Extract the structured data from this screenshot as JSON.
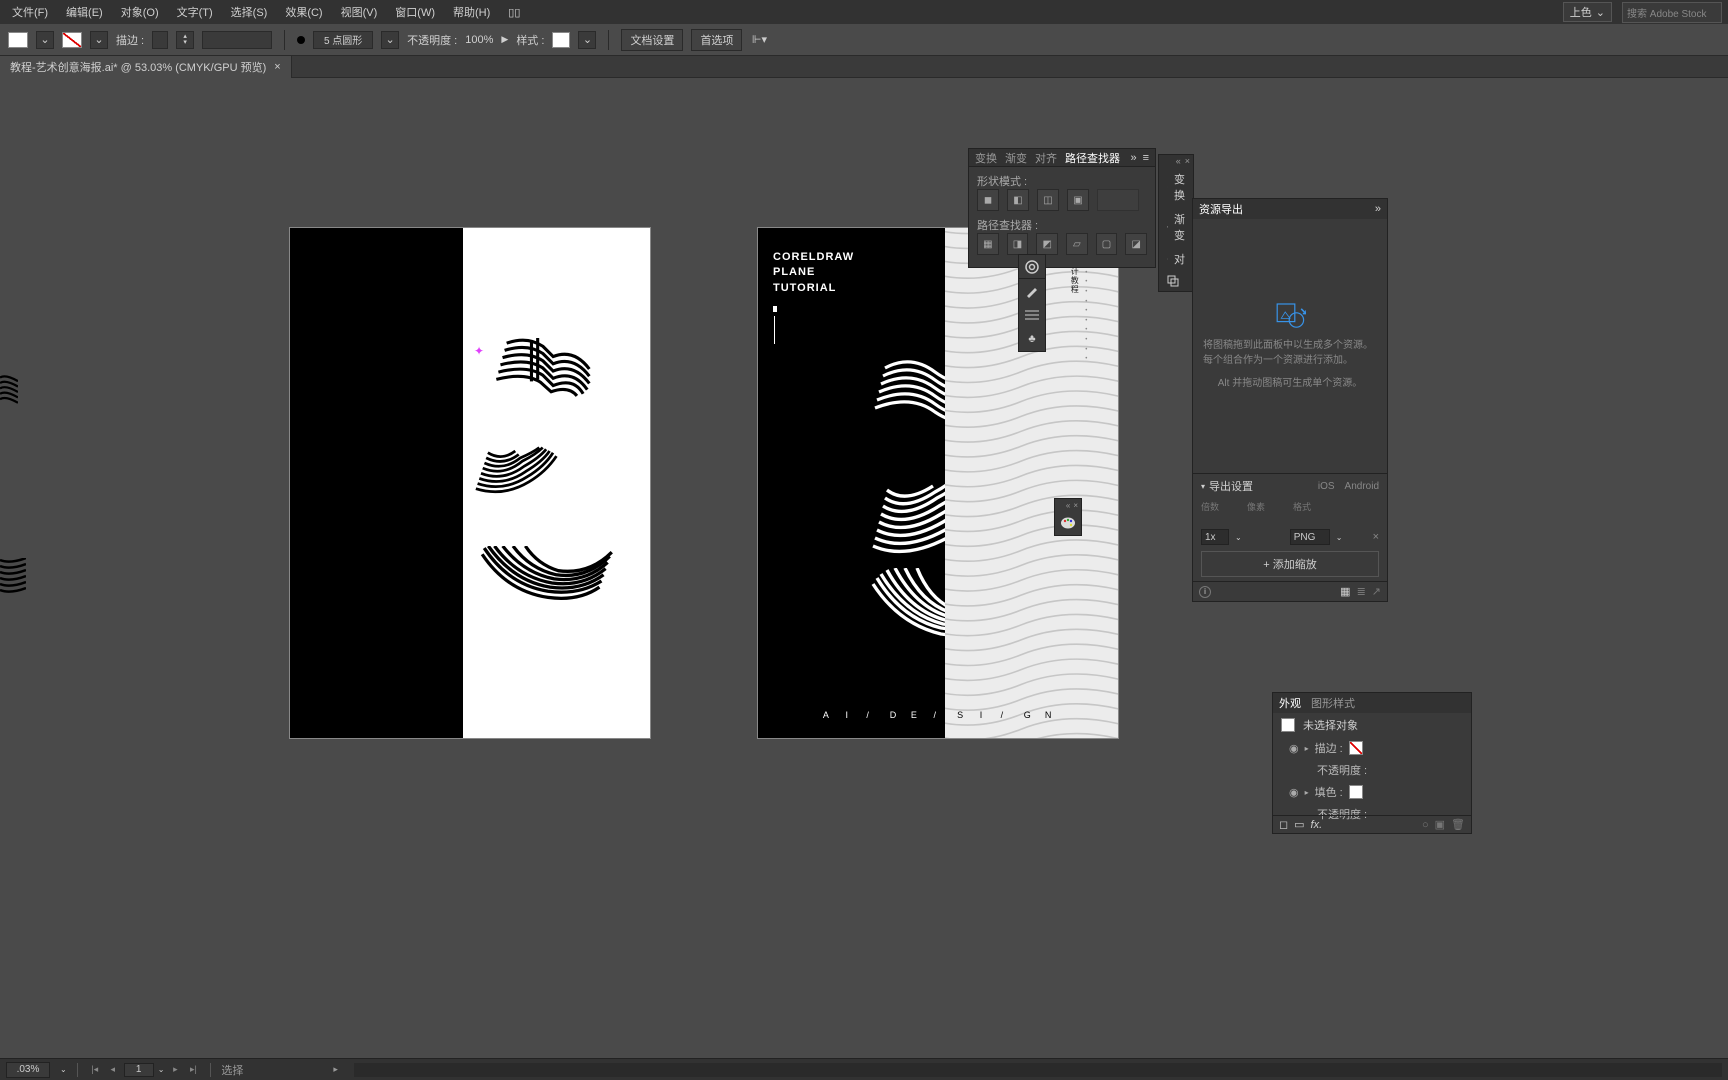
{
  "menubar": {
    "items": [
      "文件(F)",
      "编辑(E)",
      "对象(O)",
      "文字(T)",
      "选择(S)",
      "效果(C)",
      "视图(V)",
      "窗口(W)",
      "帮助(H)"
    ],
    "workspace_label": "上色",
    "search_placeholder": "搜索 Adobe Stock"
  },
  "controlbar": {
    "stroke_label": "描边 :",
    "stroke_weight": "",
    "stroke_profile": "5 点圆形",
    "opacity_label": "不透明度 :",
    "opacity_value": "100%",
    "style_label": "样式 :",
    "doc_setup": "文档设置",
    "prefs": "首选项"
  },
  "tab": {
    "title": "教程-艺术创意海报.ai* @ 53.03% (CMYK/GPU 预览)",
    "close": "×"
  },
  "poster": {
    "title_line1": "CORELDRAW",
    "title_line2": "PLANE",
    "title_line3": "TUTORIAL",
    "footer_letters": [
      "A",
      "I",
      "/",
      "D",
      "E",
      "/",
      "S",
      "I",
      "/",
      "G",
      "N"
    ]
  },
  "pathfinder": {
    "tabs": [
      "变换",
      "渐变",
      "对齐",
      "路径查找器"
    ],
    "shape_modes_label": "形状模式 :",
    "pathfinders_label": "路径查找器 :"
  },
  "panel_list": {
    "items": [
      "变换",
      "渐变",
      "对",
      "资源导出"
    ]
  },
  "asset_panel": {
    "tab": "资源导出",
    "hint1": "将图稿拖到此面板中以生成多个资源。每个组合作为一个资源进行添加。",
    "hint2": "Alt 并拖动图稿可生成单个资源。",
    "export_settings": "导出设置",
    "platforms": [
      "iOS",
      "Android"
    ],
    "scale_header": [
      "倍数",
      "像素",
      "格式"
    ],
    "scale_value": "1x",
    "format_value": "PNG",
    "add_scale": "+ 添加缩放"
  },
  "appearance": {
    "tabs": [
      "外观",
      "图形样式"
    ],
    "no_selection": "未选择对象",
    "stroke_label": "描边 :",
    "opacity_label": "不透明度 :",
    "fill_label": "填色 :",
    "opacity2_label": "不透明度 :"
  },
  "statusbar": {
    "zoom": ".03%",
    "artboard_index": "1",
    "tool": "选择"
  }
}
